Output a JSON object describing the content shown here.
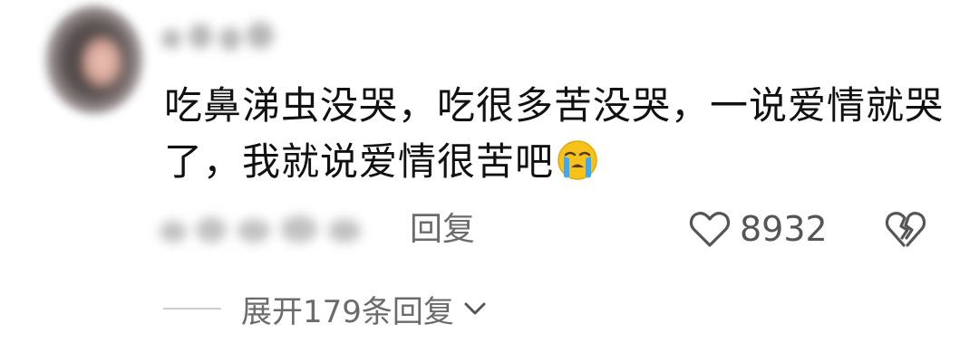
{
  "comment": {
    "content_text": "吃鼻涕虫没哭，吃很多苦没哭，一说爱情就哭了，我就说爱情很苦吧",
    "emoji": "loudly-crying-face",
    "reply_label": "回复",
    "like_count": "8932",
    "expand_label": "展开179条回复",
    "icons": {
      "like": "heart-outline-icon",
      "dislike": "broken-heart-icon",
      "expand": "chevron-down-icon"
    },
    "colors": {
      "text_primary": "#111111",
      "text_secondary": "#6b6b6b",
      "emoji_face": "#f7c21b",
      "emoji_tears": "#3da9f5"
    }
  }
}
